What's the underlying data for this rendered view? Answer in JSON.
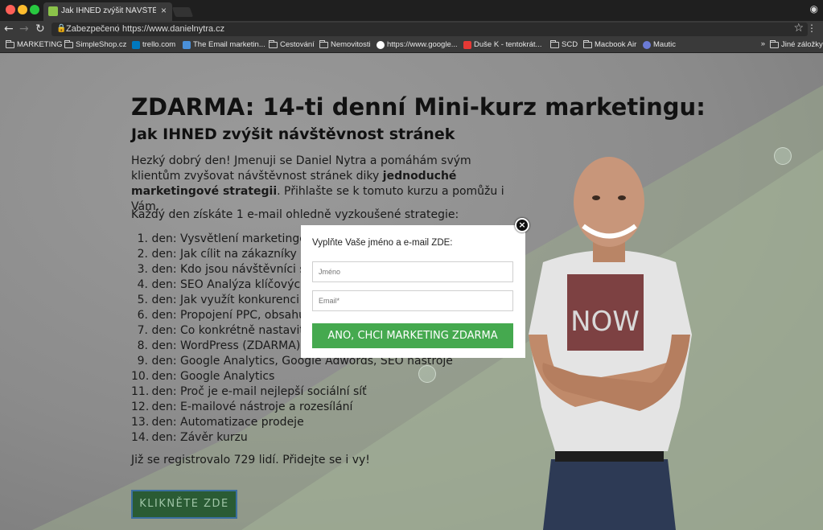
{
  "browser": {
    "tab_title": "Jak IHNED zvýšit NÁVŠTĚVNOS",
    "tab_close": "×",
    "security_label": "Zabezpečeno",
    "url": "https://www.danielnytra.cz",
    "bookmarks": [
      "MARKETING",
      "SimpleShop.cz",
      "trello.com",
      "The Email marketin...",
      "Cestování",
      "Nemovitosti",
      "https://www.google...",
      "Duše K - tentokrát...",
      "SCD",
      "Macbook Air",
      "Mautic"
    ],
    "bookmarks_overflow": "»",
    "other_bookmarks": "Jiné záložky"
  },
  "page": {
    "title": "ZDARMA: 14-ti denní Mini-kurz marketingu:",
    "subtitle": "Jak IHNED zvýšit návštěvnost stránek",
    "intro_before": "Hezký dobrý den! Jmenuji se Daniel Nytra a pomáhám svým klientům zvyšovat návštěvnost stránek diky ",
    "intro_bold": "jednoduché marketingové strategii",
    "intro_after": ". Přihlašte se k tomuto kurzu a pomůžu i Vám.",
    "daily_intro": "Každý den získáte 1 e-mail ohledně vyzkoušené strategie:",
    "days": [
      "den: Vysvětlení marketingové strategie",
      "den: Jak cílit na zákazníky",
      "den: Kdo jsou návštěvníci stránek",
      "den: SEO Analýza klíčových slov",
      "den: Jak využít konkurenci ve svůj prospěch",
      "den: Propojení PPC, obsahu, e-mailu",
      "den: Co konkrétně nastavit na stránkách",
      "den: WordPress (ZDARMA)",
      "den: Google Analytics, Google Adwords, SEO nástroje",
      "den: Google Analytics",
      "den: Proč je e-mail nejlepší sociální síť",
      "den: E-mailové nástroje a rozesílání",
      "den: Automatizace prodeje",
      "den: Závěr kurzu"
    ],
    "registered": "Již se registrovalo 729 lidí. Přidejte se i vy!",
    "cta": "KLIKNĚTE ZDE",
    "shirt_text": "NOW"
  },
  "modal": {
    "close": "×",
    "prompt": "Vyplňte Vaše jméno a e-mail ZDE:",
    "name_placeholder": "Jméno",
    "email_placeholder": "Email*",
    "submit": "ANO, CHCI MARKETING ZDARMA"
  }
}
